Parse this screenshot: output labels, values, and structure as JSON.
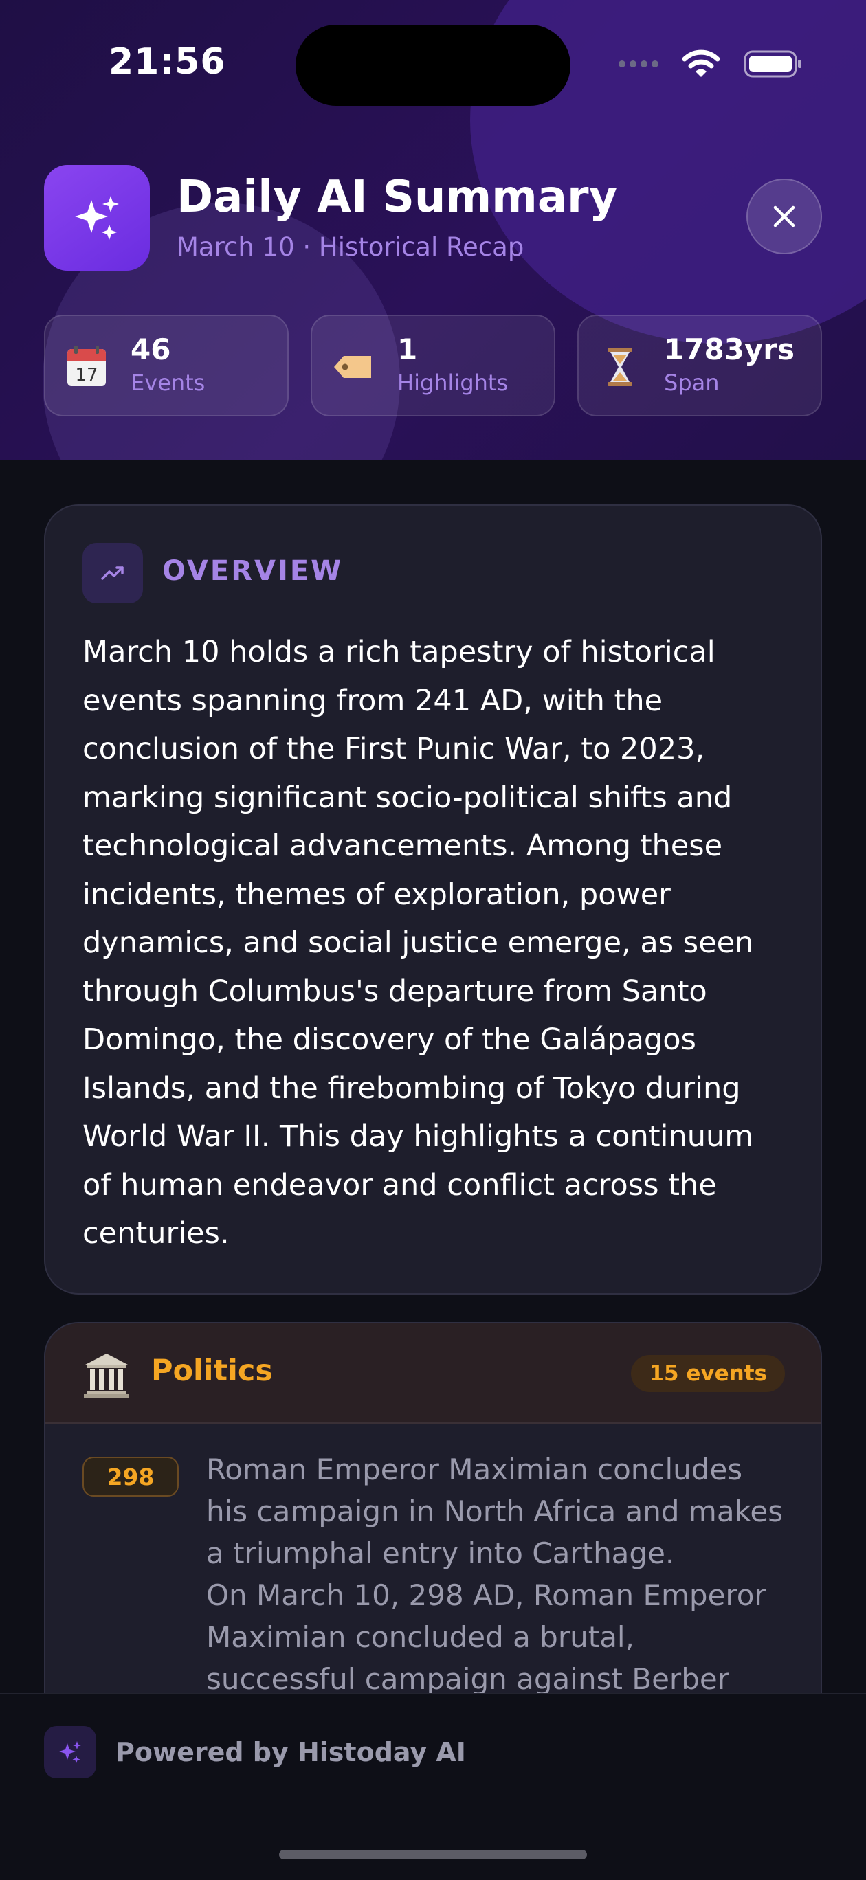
{
  "status_bar": {
    "time": "21:56"
  },
  "header": {
    "app_icon": "sparkles-icon",
    "title": "Daily AI Summary",
    "subtitle": "March 10 · Historical Recap",
    "close_icon": "close-icon"
  },
  "stats": [
    {
      "icon": "calendar-icon",
      "value": "46",
      "label": "Events"
    },
    {
      "icon": "tag-icon",
      "value": "1",
      "label": "Highlights"
    },
    {
      "icon": "hourglass-icon",
      "value": "1783yrs",
      "label": "Span"
    }
  ],
  "overview": {
    "icon": "trending-up-icon",
    "heading": "OVERVIEW",
    "body": "March 10 holds a rich tapestry of historical events spanning from 241 AD, with the conclusion of the First Punic War, to 2023, marking significant socio-political shifts and technological advancements. Among these incidents, themes of exploration, power dynamics, and social justice emerge, as seen through Columbus's departure from Santo Domingo, the discovery of the Galápagos Islands, and the firebombing of Tokyo during World War II. This day highlights a continuum of human endeavor and conflict across the centuries."
  },
  "politics": {
    "icon": "classical-building-icon",
    "title": "Politics",
    "count": "15 events",
    "events": [
      {
        "year": "298",
        "summary": "Roman Emperor Maximian concludes his campaign in North Africa and makes a triumphal entry into Carthage.",
        "detail": "On March 10, 298 AD, Roman Emperor Maximian concluded a brutal, successful campaign against Berber"
      }
    ]
  },
  "footer": {
    "text": "Powered by Histoday AI"
  },
  "colors": {
    "accent_purple": "#a584e6",
    "politics_orange": "#f5a623",
    "background": "#0e0f17",
    "card": "#1e1e2c"
  }
}
